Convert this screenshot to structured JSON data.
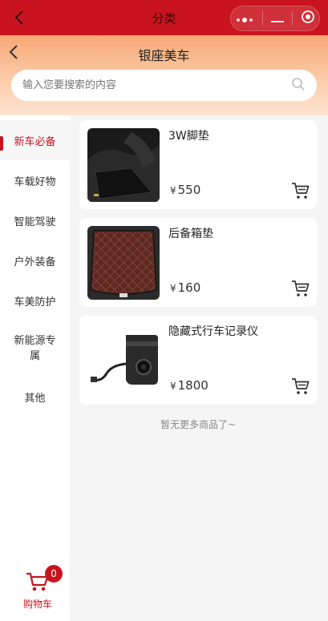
{
  "topbar": {
    "title": "分类"
  },
  "header": {
    "title": "银座美车"
  },
  "search": {
    "placeholder": "输入您要搜索的内容",
    "value": ""
  },
  "sidebar": {
    "items": [
      {
        "label": "新车必备",
        "active": true
      },
      {
        "label": "车载好物"
      },
      {
        "label": "智能驾驶"
      },
      {
        "label": "户外装备"
      },
      {
        "label": "车美防护"
      },
      {
        "label": "新能源专属"
      },
      {
        "label": "其他"
      }
    ]
  },
  "cart": {
    "count": "0",
    "label": "购物车"
  },
  "products": [
    {
      "name": "3W脚垫",
      "currency": "¥",
      "price": "550",
      "image_icon": "floor-mat-image"
    },
    {
      "name": "后备箱垫",
      "currency": "¥",
      "price": "160",
      "image_icon": "trunk-mat-image"
    },
    {
      "name": "隐藏式行车记录仪",
      "currency": "¥",
      "price": "1800",
      "image_icon": "dashcam-image"
    }
  ],
  "footer_note": "暂无更多商品了~",
  "colors": {
    "accent": "#c9141f",
    "header_start": "#f7a774",
    "header_end": "#fde4d2"
  }
}
